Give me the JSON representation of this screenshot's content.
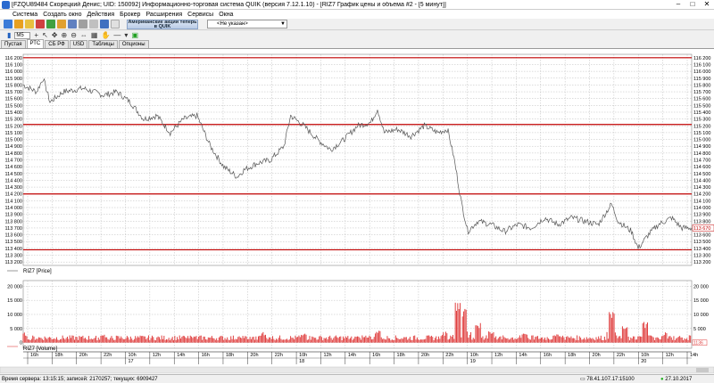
{
  "window": {
    "title": "[FZQU89484 Скорецкий Денис; UID: 150092] Информационно-торговая система QUIK (версия 7.12.1.10) - [RIZ7 График цены и объема #2 - [5 минут]]"
  },
  "menu": [
    "Система",
    "Создать окно",
    "Действия",
    "Брокер",
    "Расширения",
    "Сервисы",
    "Окна"
  ],
  "toolbar": {
    "banner": "Американские акции теперь в QUIK",
    "account_select": "<Не указан>",
    "interval": "M5"
  },
  "tabs": [
    "Пустая",
    "РТС",
    "СБ РФ",
    "USD",
    "Таблицы",
    "Опционы"
  ],
  "active_tab": "РТС",
  "price_panel": {
    "label": "RIZ7 [Price]",
    "price_ticks": [
      113200,
      113300,
      113400,
      113500,
      113600,
      113700,
      113800,
      113900,
      114000,
      114100,
      114200,
      114300,
      114400,
      114500,
      114600,
      114700,
      114800,
      114900,
      115000,
      115100,
      115200,
      115300,
      115400,
      115500,
      115600,
      115700,
      115800,
      115900,
      116000,
      116100,
      116200
    ],
    "price_tick_labels": [
      "113 200",
      "113 300",
      "113 400",
      "113 500",
      "113 600",
      "113 700",
      "113 800",
      "113 900",
      "114 000",
      "114 100",
      "114 200",
      "114 300",
      "114 400",
      "114 500",
      "114 600",
      "114 700",
      "114 800",
      "114 900",
      "115 000",
      "115 100",
      "115 200",
      "115 300",
      "115 400",
      "115 500",
      "115 600",
      "115 700",
      "115 800",
      "115 900",
      "116 000",
      "116 100",
      "116 200"
    ],
    "levels": [
      116200,
      115220,
      114200,
      113380
    ],
    "last_price_label": "113 670",
    "level_color": "#c00000",
    "line_color": "#555555"
  },
  "volume_panel": {
    "label": "RIZ7 [Volume]",
    "volume_ticks": [
      0,
      5000,
      10000,
      15000,
      20000
    ],
    "volume_tick_labels_left": [
      "0",
      "5 000",
      "10 000",
      "15 000",
      "20 000"
    ],
    "volume_tick_labels_right": [
      "0",
      "5 000",
      "10 000",
      "15 000",
      "20 000"
    ],
    "last_volume_label": "1136",
    "bar_color": "#e04040"
  },
  "chart_data": {
    "type": "line",
    "title": "RIZ7 График цены и объема #2 - [5 минут]",
    "price_series": [
      {
        "t": 0.0,
        "p": 115800
      },
      {
        "t": 0.02,
        "p": 115700
      },
      {
        "t": 0.03,
        "p": 115900
      },
      {
        "t": 0.04,
        "p": 115550
      },
      {
        "t": 0.06,
        "p": 115700
      },
      {
        "t": 0.09,
        "p": 115750
      },
      {
        "t": 0.12,
        "p": 115650
      },
      {
        "t": 0.14,
        "p": 115700
      },
      {
        "t": 0.16,
        "p": 115550
      },
      {
        "t": 0.18,
        "p": 115300
      },
      {
        "t": 0.2,
        "p": 115350
      },
      {
        "t": 0.22,
        "p": 115100
      },
      {
        "t": 0.24,
        "p": 115300
      },
      {
        "t": 0.26,
        "p": 115350
      },
      {
        "t": 0.28,
        "p": 114900
      },
      {
        "t": 0.3,
        "p": 114600
      },
      {
        "t": 0.32,
        "p": 114450
      },
      {
        "t": 0.33,
        "p": 114550
      },
      {
        "t": 0.35,
        "p": 114650
      },
      {
        "t": 0.37,
        "p": 114700
      },
      {
        "t": 0.39,
        "p": 114900
      },
      {
        "t": 0.4,
        "p": 115350
      },
      {
        "t": 0.42,
        "p": 115200
      },
      {
        "t": 0.44,
        "p": 115000
      },
      {
        "t": 0.46,
        "p": 114850
      },
      {
        "t": 0.48,
        "p": 115000
      },
      {
        "t": 0.5,
        "p": 115200
      },
      {
        "t": 0.52,
        "p": 115250
      },
      {
        "t": 0.53,
        "p": 115450
      },
      {
        "t": 0.54,
        "p": 115100
      },
      {
        "t": 0.56,
        "p": 115150
      },
      {
        "t": 0.58,
        "p": 115050
      },
      {
        "t": 0.6,
        "p": 115200
      },
      {
        "t": 0.62,
        "p": 115100
      },
      {
        "t": 0.635,
        "p": 115150
      },
      {
        "t": 0.645,
        "p": 114700
      },
      {
        "t": 0.655,
        "p": 114100
      },
      {
        "t": 0.665,
        "p": 113650
      },
      {
        "t": 0.68,
        "p": 113800
      },
      {
        "t": 0.7,
        "p": 113750
      },
      {
        "t": 0.72,
        "p": 113650
      },
      {
        "t": 0.74,
        "p": 113750
      },
      {
        "t": 0.76,
        "p": 113700
      },
      {
        "t": 0.78,
        "p": 113850
      },
      {
        "t": 0.8,
        "p": 113750
      },
      {
        "t": 0.82,
        "p": 113850
      },
      {
        "t": 0.84,
        "p": 113800
      },
      {
        "t": 0.86,
        "p": 113750
      },
      {
        "t": 0.88,
        "p": 114050
      },
      {
        "t": 0.89,
        "p": 113800
      },
      {
        "t": 0.91,
        "p": 113650
      },
      {
        "t": 0.92,
        "p": 113400
      },
      {
        "t": 0.935,
        "p": 113600
      },
      {
        "t": 0.95,
        "p": 113750
      },
      {
        "t": 0.97,
        "p": 113850
      },
      {
        "t": 0.985,
        "p": 113700
      },
      {
        "t": 1.0,
        "p": 113700
      }
    ],
    "volume_spikes": [
      {
        "t": 0.0,
        "v": 4000
      },
      {
        "t": 0.12,
        "v": 3000
      },
      {
        "t": 0.25,
        "v": 2500
      },
      {
        "t": 0.33,
        "v": 2000
      },
      {
        "t": 0.36,
        "v": 4000
      },
      {
        "t": 0.42,
        "v": 3500
      },
      {
        "t": 0.5,
        "v": 2500
      },
      {
        "t": 0.53,
        "v": 4500
      },
      {
        "t": 0.63,
        "v": 4000
      },
      {
        "t": 0.65,
        "v": 16000
      },
      {
        "t": 0.66,
        "v": 12000
      },
      {
        "t": 0.68,
        "v": 8000
      },
      {
        "t": 0.7,
        "v": 5000
      },
      {
        "t": 0.75,
        "v": 4000
      },
      {
        "t": 0.8,
        "v": 3500
      },
      {
        "t": 0.88,
        "v": 11000
      },
      {
        "t": 0.9,
        "v": 6000
      },
      {
        "t": 0.93,
        "v": 8000
      },
      {
        "t": 0.96,
        "v": 4000
      },
      {
        "t": 1.0,
        "v": 3000
      }
    ],
    "x_ticks": [
      "16h",
      "18h",
      "20h",
      "22h",
      "10h",
      "12h",
      "14h",
      "16h",
      "18h",
      "20h",
      "22h",
      "10h",
      "12h",
      "14h",
      "16h",
      "18h",
      "20h",
      "22h",
      "10h",
      "12h",
      "14h",
      "16h",
      "18h",
      "20h",
      "22h",
      "10h",
      "12h",
      "14h"
    ],
    "day_labels": [
      {
        "label": "17",
        "tick_index": 4
      },
      {
        "label": "18",
        "tick_index": 11
      },
      {
        "label": "19",
        "tick_index": 18
      },
      {
        "label": "20",
        "tick_index": 25
      }
    ],
    "ylim_price": [
      113150,
      116250
    ],
    "ylim_volume": [
      -2000,
      22000
    ]
  },
  "status": {
    "server_time": "Время сервера: 13:15:15; записей: 2170257; текущих: 6909427",
    "connection": "78.41.107.17:15100",
    "date": "27.10.2017"
  }
}
